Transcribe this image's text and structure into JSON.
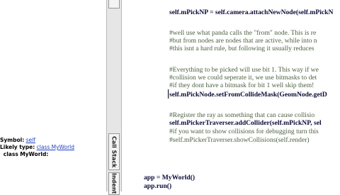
{
  "symbol_info": {
    "symbol_label": "Symbol:",
    "symbol_value": "self",
    "type_label": "Likely type:",
    "type_value": "class MyWorld",
    "class_keyword": "class",
    "class_name": "MyWorld:"
  },
  "tabs": {
    "call_stack": "Call Stack",
    "indent": "Indent"
  },
  "editor": {
    "lines": [
      {
        "kind": "code",
        "text": "self.mPickNP = self.camera.attachNewNode(self.mPickN"
      },
      {
        "kind": "comment",
        "text": "#well use what panda calls the \"from\" node.  This is re"
      },
      {
        "kind": "comment",
        "text": "#but from nodes are nodes that are active, while into n"
      },
      {
        "kind": "comment",
        "text": "#this isnt a hard rule, but following it usually reduces"
      },
      {
        "kind": "comment",
        "text": "#Everything to be picked will use bit 1. This way if we"
      },
      {
        "kind": "comment",
        "text": "#collision we could seperate it, we use bitmasks to det"
      },
      {
        "kind": "comment",
        "text": "#if they dont have a bitmask for bit 1 well skip them!"
      },
      {
        "kind": "code",
        "text": "self.mPickNode.setFromCollideMask(GeomNode.getD"
      },
      {
        "kind": "comment",
        "text": "#Register the ray as something that can cause collisio"
      },
      {
        "kind": "code",
        "text": "self.mPickerTraverser.addCollider(self.mPickNP, sel"
      },
      {
        "kind": "comment",
        "text": "#if you want to show collisions for debugging turn this"
      },
      {
        "kind": "comment",
        "text": "#self.mPickerTraverser.showCollisions(self.render)"
      },
      {
        "kind": "code",
        "text": "app = MyWorld()"
      },
      {
        "kind": "code",
        "text": "app.run()"
      }
    ]
  },
  "colors": {
    "code": "#0b0b3a",
    "comment": "#4a5f3f",
    "link": "#1f3fbf"
  }
}
